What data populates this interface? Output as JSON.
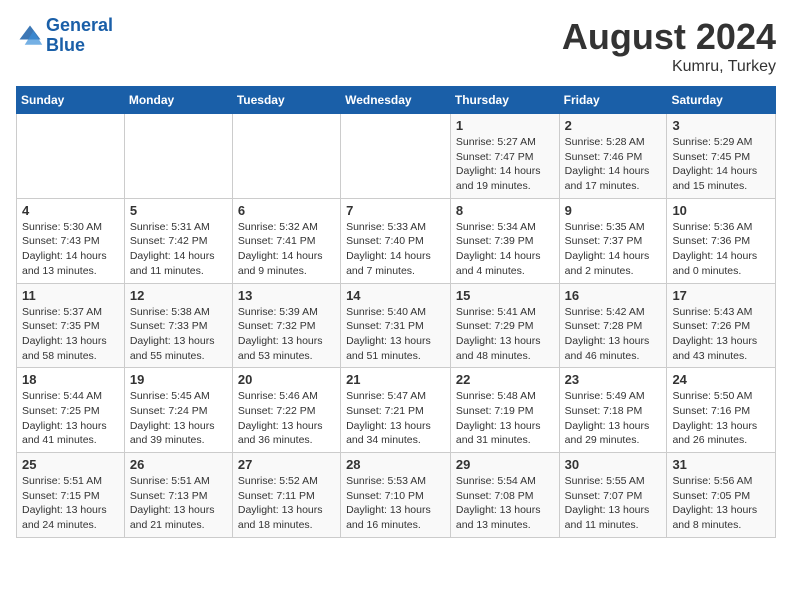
{
  "header": {
    "logo_line1": "General",
    "logo_line2": "Blue",
    "month_year": "August 2024",
    "location": "Kumru, Turkey"
  },
  "weekdays": [
    "Sunday",
    "Monday",
    "Tuesday",
    "Wednesday",
    "Thursday",
    "Friday",
    "Saturday"
  ],
  "weeks": [
    [
      {
        "day": "",
        "info": ""
      },
      {
        "day": "",
        "info": ""
      },
      {
        "day": "",
        "info": ""
      },
      {
        "day": "",
        "info": ""
      },
      {
        "day": "1",
        "info": "Sunrise: 5:27 AM\nSunset: 7:47 PM\nDaylight: 14 hours and 19 minutes."
      },
      {
        "day": "2",
        "info": "Sunrise: 5:28 AM\nSunset: 7:46 PM\nDaylight: 14 hours and 17 minutes."
      },
      {
        "day": "3",
        "info": "Sunrise: 5:29 AM\nSunset: 7:45 PM\nDaylight: 14 hours and 15 minutes."
      }
    ],
    [
      {
        "day": "4",
        "info": "Sunrise: 5:30 AM\nSunset: 7:43 PM\nDaylight: 14 hours and 13 minutes."
      },
      {
        "day": "5",
        "info": "Sunrise: 5:31 AM\nSunset: 7:42 PM\nDaylight: 14 hours and 11 minutes."
      },
      {
        "day": "6",
        "info": "Sunrise: 5:32 AM\nSunset: 7:41 PM\nDaylight: 14 hours and 9 minutes."
      },
      {
        "day": "7",
        "info": "Sunrise: 5:33 AM\nSunset: 7:40 PM\nDaylight: 14 hours and 7 minutes."
      },
      {
        "day": "8",
        "info": "Sunrise: 5:34 AM\nSunset: 7:39 PM\nDaylight: 14 hours and 4 minutes."
      },
      {
        "day": "9",
        "info": "Sunrise: 5:35 AM\nSunset: 7:37 PM\nDaylight: 14 hours and 2 minutes."
      },
      {
        "day": "10",
        "info": "Sunrise: 5:36 AM\nSunset: 7:36 PM\nDaylight: 14 hours and 0 minutes."
      }
    ],
    [
      {
        "day": "11",
        "info": "Sunrise: 5:37 AM\nSunset: 7:35 PM\nDaylight: 13 hours and 58 minutes."
      },
      {
        "day": "12",
        "info": "Sunrise: 5:38 AM\nSunset: 7:33 PM\nDaylight: 13 hours and 55 minutes."
      },
      {
        "day": "13",
        "info": "Sunrise: 5:39 AM\nSunset: 7:32 PM\nDaylight: 13 hours and 53 minutes."
      },
      {
        "day": "14",
        "info": "Sunrise: 5:40 AM\nSunset: 7:31 PM\nDaylight: 13 hours and 51 minutes."
      },
      {
        "day": "15",
        "info": "Sunrise: 5:41 AM\nSunset: 7:29 PM\nDaylight: 13 hours and 48 minutes."
      },
      {
        "day": "16",
        "info": "Sunrise: 5:42 AM\nSunset: 7:28 PM\nDaylight: 13 hours and 46 minutes."
      },
      {
        "day": "17",
        "info": "Sunrise: 5:43 AM\nSunset: 7:26 PM\nDaylight: 13 hours and 43 minutes."
      }
    ],
    [
      {
        "day": "18",
        "info": "Sunrise: 5:44 AM\nSunset: 7:25 PM\nDaylight: 13 hours and 41 minutes."
      },
      {
        "day": "19",
        "info": "Sunrise: 5:45 AM\nSunset: 7:24 PM\nDaylight: 13 hours and 39 minutes."
      },
      {
        "day": "20",
        "info": "Sunrise: 5:46 AM\nSunset: 7:22 PM\nDaylight: 13 hours and 36 minutes."
      },
      {
        "day": "21",
        "info": "Sunrise: 5:47 AM\nSunset: 7:21 PM\nDaylight: 13 hours and 34 minutes."
      },
      {
        "day": "22",
        "info": "Sunrise: 5:48 AM\nSunset: 7:19 PM\nDaylight: 13 hours and 31 minutes."
      },
      {
        "day": "23",
        "info": "Sunrise: 5:49 AM\nSunset: 7:18 PM\nDaylight: 13 hours and 29 minutes."
      },
      {
        "day": "24",
        "info": "Sunrise: 5:50 AM\nSunset: 7:16 PM\nDaylight: 13 hours and 26 minutes."
      }
    ],
    [
      {
        "day": "25",
        "info": "Sunrise: 5:51 AM\nSunset: 7:15 PM\nDaylight: 13 hours and 24 minutes."
      },
      {
        "day": "26",
        "info": "Sunrise: 5:51 AM\nSunset: 7:13 PM\nDaylight: 13 hours and 21 minutes."
      },
      {
        "day": "27",
        "info": "Sunrise: 5:52 AM\nSunset: 7:11 PM\nDaylight: 13 hours and 18 minutes."
      },
      {
        "day": "28",
        "info": "Sunrise: 5:53 AM\nSunset: 7:10 PM\nDaylight: 13 hours and 16 minutes."
      },
      {
        "day": "29",
        "info": "Sunrise: 5:54 AM\nSunset: 7:08 PM\nDaylight: 13 hours and 13 minutes."
      },
      {
        "day": "30",
        "info": "Sunrise: 5:55 AM\nSunset: 7:07 PM\nDaylight: 13 hours and 11 minutes."
      },
      {
        "day": "31",
        "info": "Sunrise: 5:56 AM\nSunset: 7:05 PM\nDaylight: 13 hours and 8 minutes."
      }
    ]
  ]
}
